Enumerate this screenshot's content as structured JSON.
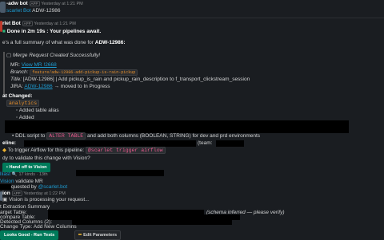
{
  "header": {
    "bot_name": "-adw bot",
    "app_badge": "APP",
    "time": "Yesterday at 1:21 PM",
    "mention": "scarlet Bot",
    "ticket": "ADW-12986"
  },
  "message2": {
    "sender": "rlet Bot",
    "app_badge": "APP",
    "time": "Yesterday at 1:21 PM",
    "title": "Done in 2m 19s : Your pipelines await.",
    "summary_prefix": "e's a full summary of what was done for ",
    "summary_ticket": "ADW-12986:"
  },
  "quote": {
    "headline": "Merge Request Created Successfully!",
    "mr_label": "MR:",
    "mr_link": "View MR !2668",
    "branch_label": "Branch:",
    "branch_value": "feature/adw-12986-add-pickup-is-rain-pickup",
    "title_label": "Title:",
    "title_value": "[ADW-12986] | Add pickup_is_rain and pickup_rain_description to f_transport_clickstream_session",
    "jira_label": "JIRA:",
    "jira_ticket": "ADW-12986",
    "jira_suffix": "→ moved to In Progress"
  },
  "changes": {
    "heading": "at Changed:",
    "folder": "analytics",
    "item1": "Added table alias",
    "item2": "Added",
    "ddl_prefix": "DDL script to",
    "ddl_code": "ALTER TABLE",
    "ddl_suffix": "and add both columns (BOOLEAN, STRING) for dev and prd environments",
    "pipeline_label": "eline:",
    "team_label": "(team:",
    "airflow_prefix": "To trigger Airflow for this pipeline:",
    "airflow_code": "@scarlet trigger airflow",
    "validate_q": "dy to validate this change with Vision?"
  },
  "actions1": {
    "handoff": "Hand off to Vision"
  },
  "thread": {
    "name": "lliast",
    "reply_count": "17 kinds · 13th"
  },
  "vision_msg": {
    "mention": "Vision",
    "text": "validate MR",
    "requested_prefix": "quested by",
    "requested_user": "@scarlet.bot"
  },
  "vision_reply": {
    "sender": "ion",
    "app_badge": "APP",
    "time": "Yesterday at 1:22 PM",
    "processing": "Vision is processing your request...",
    "ext_heading": "t Extraction Summary",
    "target_label": "arget Table:",
    "schema_note": "(schema inferred — please verify)",
    "compare_label": "compare Table:",
    "detected_label": "Detected Columns (2):",
    "change_type": "Change Type: Add New Columns"
  },
  "actions2": {
    "looks_good": "Looks Good - Run Tests",
    "edit_params": "Edit Parameters",
    "edit_icon_char": "✏"
  },
  "colors": {
    "background": "#1a1d21",
    "link": "#1d9bd1",
    "green_button": "#007a5a",
    "code_orange": "#e8912d",
    "code_pink": "#e8598d"
  }
}
